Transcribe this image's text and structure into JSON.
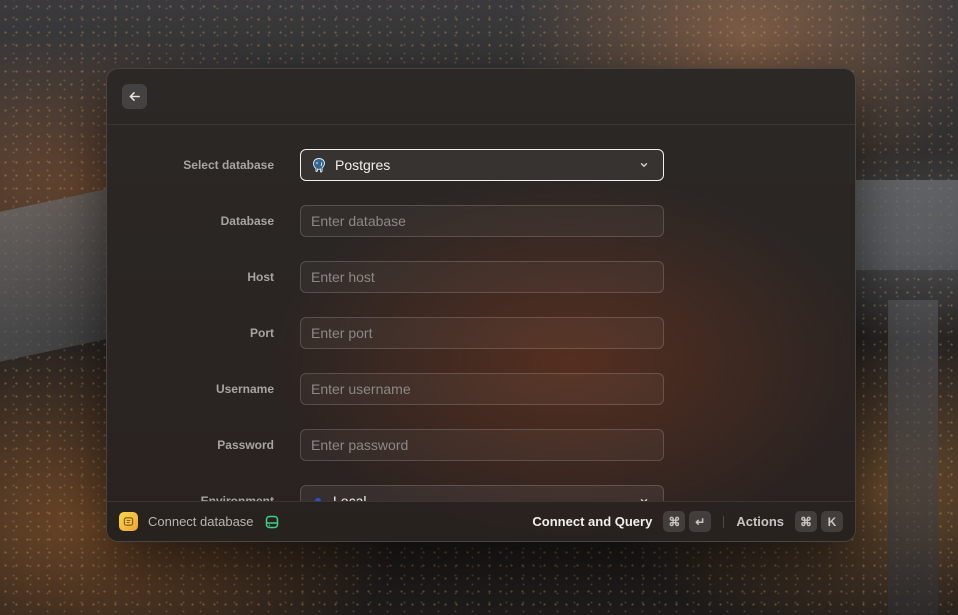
{
  "form": {
    "select_database": {
      "label": "Select database",
      "value": "Postgres",
      "icon": "postgres-elephant-icon"
    },
    "fields": [
      {
        "label": "Database",
        "placeholder": "Enter database",
        "value": ""
      },
      {
        "label": "Host",
        "placeholder": "Enter host",
        "value": ""
      },
      {
        "label": "Port",
        "placeholder": "Enter port",
        "value": ""
      },
      {
        "label": "Username",
        "placeholder": "Enter username",
        "value": ""
      },
      {
        "label": "Password",
        "placeholder": "Enter password",
        "value": ""
      }
    ],
    "environment": {
      "label": "Environment",
      "value": "Local",
      "dot_color": "#2f4fd8"
    }
  },
  "footer": {
    "title": "Connect database",
    "primary_action": "Connect and Query",
    "primary_shortcut": [
      "⌘",
      "↵"
    ],
    "actions_label": "Actions",
    "actions_shortcut": [
      "⌘",
      "K"
    ]
  },
  "colors": {
    "accent_db_icon": "#3ecf8e",
    "app_icon": "#f7d84a"
  }
}
